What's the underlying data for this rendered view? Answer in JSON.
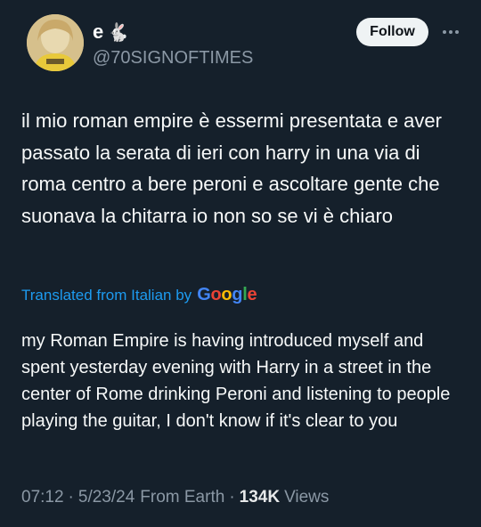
{
  "user": {
    "display_name": "e",
    "display_name_emoji": "🐇",
    "handle": "@70SIGNOFTIMES",
    "avatar_icon": "profile-avatar-photo"
  },
  "actions": {
    "follow_label": "Follow",
    "more_icon": "more-horizontal-icon"
  },
  "tweet": {
    "text": "il mio roman empire è essermi presentata e aver passato la serata di ieri con harry in una via di roma centro a bere peroni e ascoltare gente che suonava la chitarra io non so se vi è chiaro",
    "translated_label": "Translated from Italian by",
    "translator_brand": "Google",
    "translation": "my Roman Empire is having introduced myself and spent yesterday evening with Harry in a street in the center of Rome drinking Peroni and listening to people playing the guitar, I don't know if it's clear to you"
  },
  "meta": {
    "time": "07:12",
    "date": "5/23/24",
    "source": "From Earth",
    "views_count": "134K",
    "views_label": "Views"
  },
  "colors": {
    "background": "#15202b",
    "link": "#1d9bf0",
    "muted": "#8b98a5"
  }
}
